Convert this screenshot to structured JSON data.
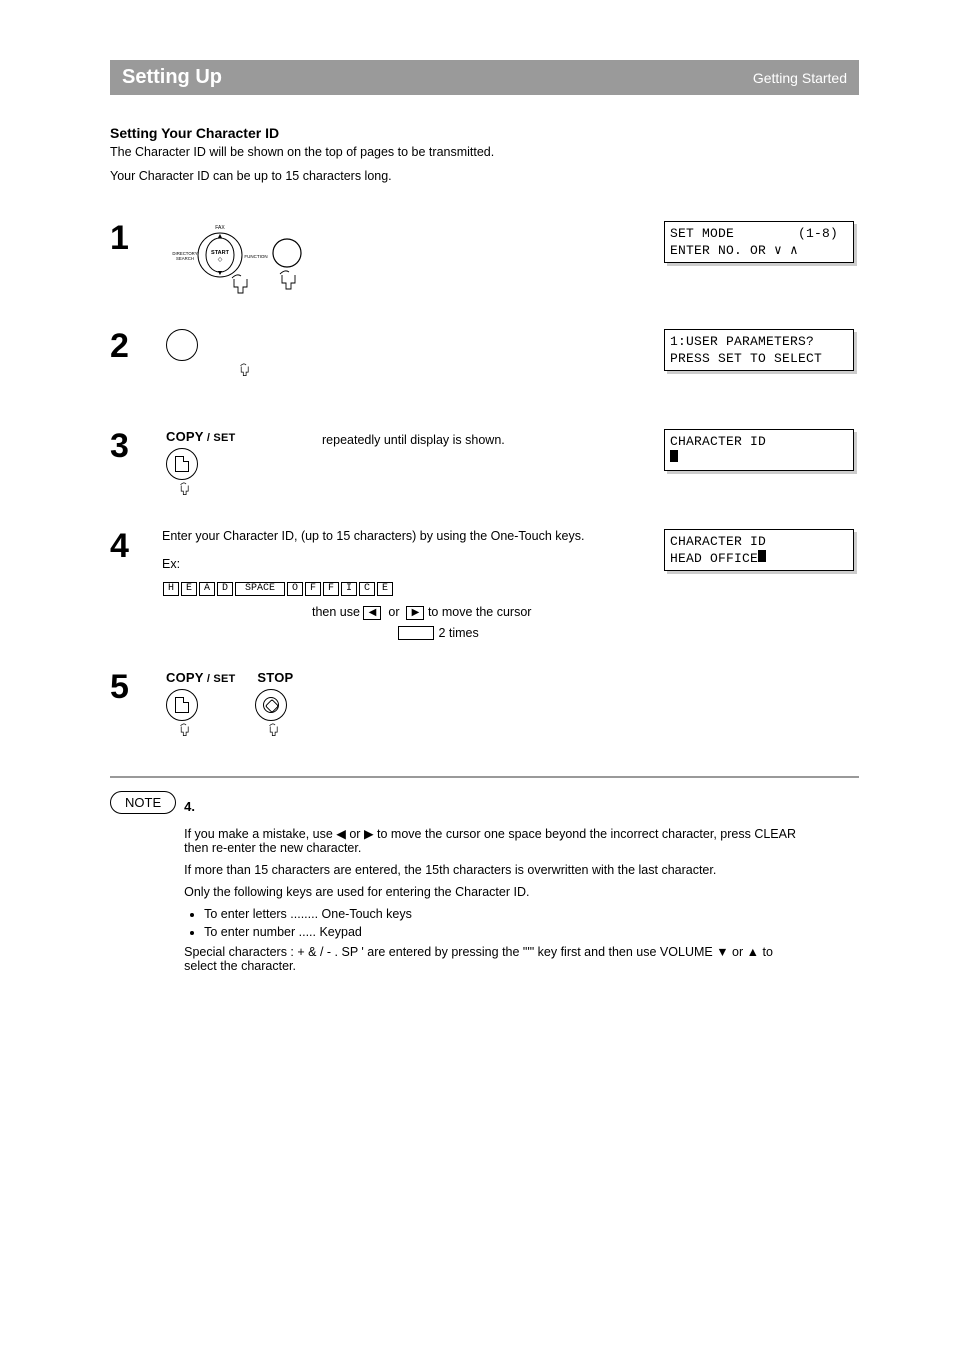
{
  "header": {
    "title": "Setting Up",
    "right": "Getting Started"
  },
  "section_title": "Setting Your Character ID",
  "intro_line1": "The Character ID will be shown on the top of pages to be transmitted.",
  "intro_line2": "Your Character ID can be up to 15 characters long.",
  "steps": [
    {
      "n": "1",
      "mid": "",
      "lcd_line1": "SET MODE        (1-8)",
      "lcd_line2": "ENTER NO. OR ∨ ∧"
    },
    {
      "n": "2",
      "mid": "",
      "lcd_line1": "1:USER PARAMETERS?",
      "lcd_line2": "PRESS SET TO SELECT"
    },
    {
      "n": "3",
      "mid": "repeatedly until display is shown.",
      "lcd_line1": "CHARACTER ID",
      "lcd_line2_prefix": ""
    },
    {
      "n": "4",
      "mid_pre": "Enter your Character ID, (up to 15 characters) by using the One-Touch keys.\n\nEx:",
      "example_keys": [
        "H",
        "E",
        "A",
        "D",
        "SPACE",
        "O",
        "F",
        "F",
        "I",
        "C",
        "E"
      ],
      "arrow_hint_pre": "then use ",
      "arrow_hint_post": " to move the cursor",
      "keys_row2": "2 times",
      "lcd_line1": "CHARACTER ID",
      "lcd_line2_prefix": "HEAD OFFICE"
    },
    {
      "n": "5",
      "mid": "",
      "lcd": null
    }
  ],
  "notes": {
    "heading": "NOTE",
    "subhead": "4.",
    "items": [
      "If you make a mistake, use ◀ or ▶ to move the cursor one space beyond the incorrect character, press CLEAR then re-enter the new character.",
      "If more than 15 characters are entered, the 15th characters is overwritten with the last character.",
      "Only the following keys are used for entering the Character ID.",
      "To enter letters ........ One-Touch keys",
      "To enter number ..... Keypad",
      "Special characters : +  &  /  -  .  SP  '  are entered by pressing the \"'\" key first and then use VOLUME   ▼   or   ▲   to select the character."
    ]
  },
  "labels": {
    "copy_set": "COPY",
    "set_suffix": " / SET",
    "stop": "STOP",
    "clear": "CLEAR"
  }
}
